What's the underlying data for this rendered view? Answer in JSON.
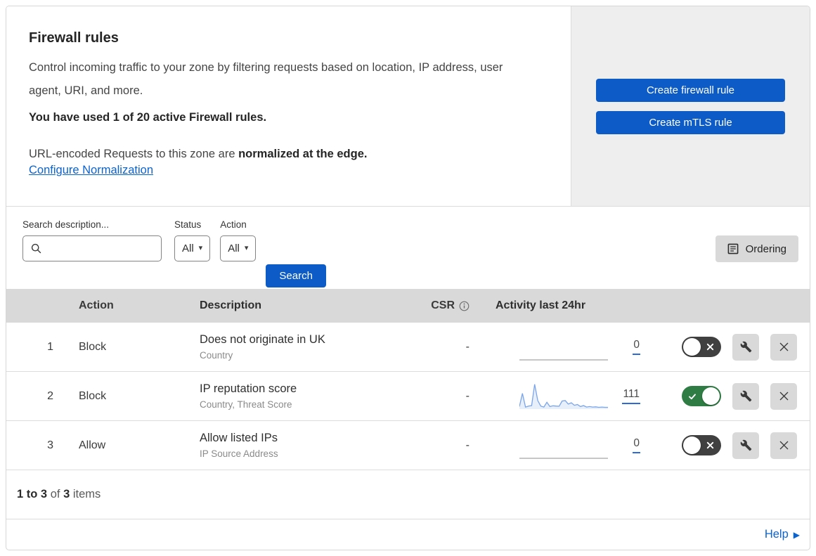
{
  "colors": {
    "accent_blue": "#0d5bc6",
    "link_blue": "#0b63d1",
    "toggle_on_green": "#2f7d44",
    "toggle_off_gray": "#404040",
    "sparkline_blue": "#7aa5ea",
    "count_underline_blue": "#2f6bd8"
  },
  "header": {
    "title": "Firewall rules",
    "description": "Control incoming traffic to your zone by filtering requests based on location, IP address, user agent, URI, and more.",
    "usage": "You have used 1 of 20 active Firewall rules.",
    "normalization_text": "URL-encoded Requests to this zone are ",
    "normalization_bold": "normalized at the edge.",
    "normalization_link": "Configure Normalization"
  },
  "actions_panel": {
    "create_firewall_rule": "Create firewall rule",
    "create_mtls_rule": "Create mTLS rule"
  },
  "filters": {
    "search_label": "Search description...",
    "status_label": "Status",
    "status_value": "All",
    "action_label": "Action",
    "action_value": "All",
    "search_button": "Search",
    "ordering_button": "Ordering"
  },
  "table": {
    "columns": {
      "action": "Action",
      "description": "Description",
      "csr": "CSR",
      "activity": "Activity last 24hr"
    },
    "rows": [
      {
        "num": "1",
        "action": "Block",
        "description": "Does not originate in UK",
        "criteria": "Country",
        "csr": "-",
        "activity_count": "0",
        "enabled": false,
        "sparkline": {
          "values": [
            0,
            0
          ],
          "color": "#a3a3a3",
          "fill_color": null
        }
      },
      {
        "num": "2",
        "action": "Block",
        "description": "IP reputation score",
        "criteria": "Country, Threat Score",
        "csr": "-",
        "activity_count": "111",
        "enabled": true,
        "sparkline": {
          "values": [
            10,
            62,
            8,
            12,
            14,
            98,
            34,
            12,
            8,
            27,
            10,
            13,
            12,
            11,
            32,
            34,
            20,
            25,
            15,
            18,
            10,
            14,
            8,
            10,
            8,
            9,
            7,
            8,
            7,
            7
          ],
          "color": "#7aa5ea",
          "fill_color": "rgba(122,165,234,0.18)"
        }
      },
      {
        "num": "3",
        "action": "Allow",
        "description": "Allow listed IPs",
        "criteria": "IP Source Address",
        "csr": "-",
        "activity_count": "0",
        "enabled": false,
        "sparkline": {
          "values": [
            0,
            0
          ],
          "color": "#a3a3a3",
          "fill_color": null
        }
      }
    ]
  },
  "footer": {
    "range": "1 to 3",
    "of_text": "of",
    "total": "3",
    "items_text": "items"
  },
  "help": {
    "label": "Help"
  }
}
